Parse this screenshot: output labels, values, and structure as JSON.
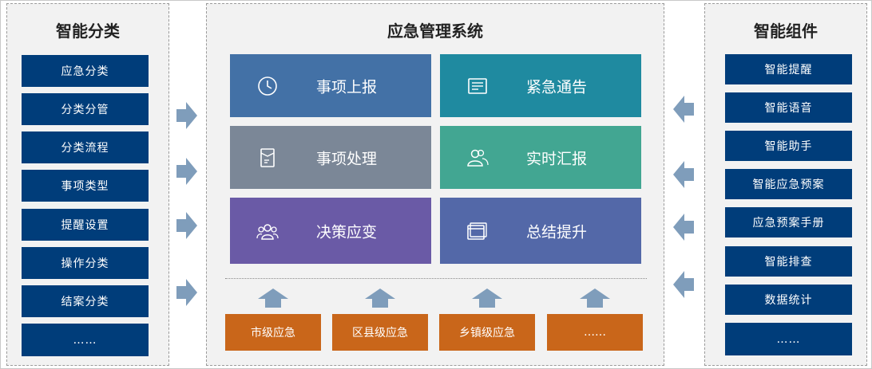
{
  "left_panel": {
    "title": "智能分类",
    "items": [
      "应急分类",
      "分类分管",
      "分类流程",
      "事项类型",
      "提醒设置",
      "操作分类",
      "结案分类",
      "……"
    ]
  },
  "center_panel": {
    "title": "应急管理系统",
    "tiles": [
      {
        "label": "事项上报",
        "icon": "clock-icon",
        "color": "#4371a6"
      },
      {
        "label": "紧急通告",
        "icon": "notice-board-icon",
        "color": "#1f8aa0"
      },
      {
        "label": "事项处理",
        "icon": "document-icon",
        "color": "#7b8797"
      },
      {
        "label": "实时汇报",
        "icon": "people-icon",
        "color": "#42a692"
      },
      {
        "label": "决策应变",
        "icon": "group-icon",
        "color": "#6a5aa6"
      },
      {
        "label": "总结提升",
        "icon": "window-icon",
        "color": "#5368a8"
      }
    ],
    "levels": [
      "市级应急",
      "区县级应急",
      "乡镇级应急",
      "……"
    ]
  },
  "right_panel": {
    "title": "智能组件",
    "items": [
      "智能提醒",
      "智能语音",
      "智能助手",
      "智能应急预案",
      "应急预案手册",
      "智能排查",
      "数据统计",
      "……"
    ]
  },
  "colors": {
    "panel_bg": "#f2f2f2",
    "blue_button": "#003d7a",
    "orange_button": "#c9661a",
    "arrow": "#7f9dbb"
  }
}
